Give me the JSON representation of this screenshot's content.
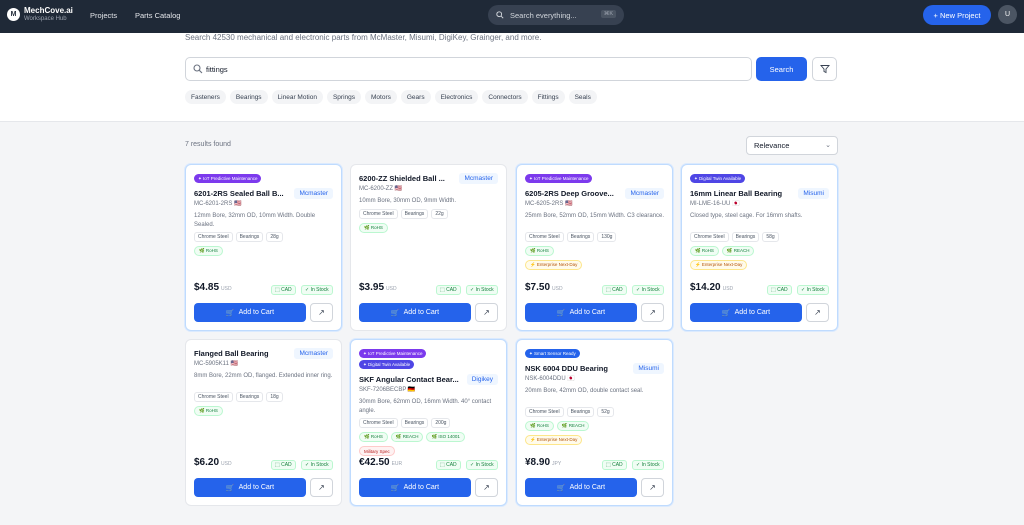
{
  "header": {
    "brand": "MechCove.ai",
    "brand_sub": "Workspace Hub",
    "logo_text": "M",
    "nav": [
      "Projects",
      "Parts Catalog"
    ],
    "search_placeholder": "Search everything...",
    "search_shortcut": "⌘K",
    "new_project": "+ New Project",
    "avatar": "U"
  },
  "hero": {
    "subtitle": "Search 42530 mechanical and electronic parts from McMaster, Misumi, DigiKey, Grainger, and more.",
    "query": "fittings",
    "search_button": "Search",
    "chips": [
      "Fasteners",
      "Bearings",
      "Linear Motion",
      "Springs",
      "Motors",
      "Gears",
      "Electronics",
      "Connectors",
      "Fittings",
      "Seals"
    ]
  },
  "results": {
    "count_text": "7 results found",
    "sort": "Relevance"
  },
  "cards": [
    {
      "badges": [
        "IoT Predictive Maintenance"
      ],
      "title": "6201-2RS Sealed Ball B...",
      "vendor": "Mcmaster",
      "sku": "MC-6201-2RS 🇺🇸",
      "desc": "12mm Bore, 32mm OD, 10mm Width. Double Sealed.",
      "tags": [
        "Chrome Steel",
        "Bearings",
        "28g"
      ],
      "certs": [
        "RoHS"
      ],
      "special": "",
      "price": "$4.85",
      "currency": "USD",
      "cad": "CAD",
      "stock": "In Stock",
      "add": "Add to Cart"
    },
    {
      "badges": [],
      "title": "6200-ZZ Shielded Ball ...",
      "vendor": "Mcmaster",
      "sku": "MC-6200-ZZ 🇺🇸",
      "desc": "10mm Bore, 30mm OD, 9mm Width.",
      "tags": [
        "Chrome Steel",
        "Bearings",
        "22g"
      ],
      "certs": [
        "RoHS"
      ],
      "special": "",
      "price": "$3.95",
      "currency": "USD",
      "cad": "CAD",
      "stock": "In Stock",
      "add": "Add to Cart"
    },
    {
      "badges": [
        "IoT Predictive Maintenance"
      ],
      "title": "6205-2RS Deep Groove...",
      "vendor": "Mcmaster",
      "sku": "MC-6205-2RS 🇺🇸",
      "desc": "25mm Bore, 52mm OD, 15mm Width. C3 clearance.",
      "tags": [
        "Chrome Steel",
        "Bearings",
        "130g"
      ],
      "certs": [
        "RoHS"
      ],
      "special": "⚡ Enterprise Next-Day",
      "price": "$7.50",
      "currency": "USD",
      "cad": "CAD",
      "stock": "In Stock",
      "add": "Add to Cart"
    },
    {
      "badges": [
        "Digital Twin Available"
      ],
      "title": "16mm Linear Ball Bearing",
      "vendor": "Misumi",
      "sku": "MI-LME-16-UU 🇯🇵",
      "desc": "Closed type, steel cage. For 16mm shafts.",
      "tags": [
        "Chrome Steel",
        "Bearings",
        "58g"
      ],
      "certs": [
        "RoHS",
        "REACH"
      ],
      "special": "⚡ Enterprise Next-Day",
      "price": "$14.20",
      "currency": "USD",
      "cad": "CAD",
      "stock": "In Stock",
      "add": "Add to Cart"
    },
    {
      "badges": [],
      "title": "Flanged Ball Bearing",
      "vendor": "Mcmaster",
      "sku": "MC-5905K11 🇺🇸",
      "desc": "8mm Bore, 22mm OD, flanged. Extended inner ring.",
      "tags": [
        "Chrome Steel",
        "Bearings",
        "18g"
      ],
      "certs": [
        "RoHS"
      ],
      "special": "",
      "price": "$6.20",
      "currency": "USD",
      "cad": "CAD",
      "stock": "In Stock",
      "add": "Add to Cart"
    },
    {
      "badges": [
        "IoT Predictive Maintenance",
        "Digital Twin Available"
      ],
      "title": "SKF Angular Contact Bear...",
      "vendor": "Digikey",
      "sku": "SKF-7206BECBP 🇩🇪",
      "desc": "30mm Bore, 62mm OD, 16mm Width. 40° contact angle.",
      "tags": [
        "Chrome Steel",
        "Bearings",
        "200g"
      ],
      "certs": [
        "RoHS",
        "REACH",
        "ISO 14001"
      ],
      "special": "Military Spec",
      "price": "€42.50",
      "currency": "EUR",
      "cad": "CAD",
      "stock": "In Stock",
      "add": "Add to Cart"
    },
    {
      "badges": [
        "Smart Sensor Ready"
      ],
      "title": "NSK 6004 DDU Bearing",
      "vendor": "Misumi",
      "sku": "NSK-6004DDU 🇯🇵",
      "desc": "20mm Bore, 42mm OD, double contact seal.",
      "tags": [
        "Chrome Steel",
        "Bearings",
        "52g"
      ],
      "certs": [
        "RoHS",
        "REACH"
      ],
      "special": "⚡ Enterprise Next-Day",
      "price": "¥8.90",
      "currency": "JPY",
      "cad": "CAD",
      "stock": "In Stock",
      "add": "Add to Cart"
    }
  ],
  "colors": {
    "accent": "#2563eb",
    "topbar": "#1f2937",
    "badge_iot": "#7c3aed",
    "badge_twin": "#4f46e5",
    "badge_sensor": "#2563eb"
  }
}
